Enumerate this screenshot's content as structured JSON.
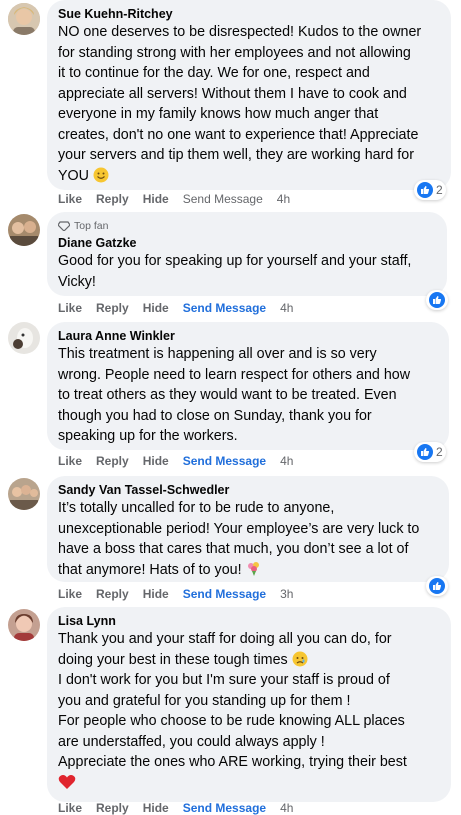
{
  "comments": [
    {
      "author": "Sue Kuehn-Ritchey",
      "lines": [
        "NO one deserves to be disrespected! Kudos to the owner",
        "for standing strong with her employees and not allowing",
        "it to continue for the day. We for one, respect and",
        "appreciate all servers! Without them I have to cook and",
        "everyone in my family knows how much anger that",
        "creates, don't no one want to experience that! Appreciate",
        "your servers and tip them well, they are working hard for",
        "YOU"
      ],
      "actions": {
        "like": "Like",
        "reply": "Reply",
        "hide": "Hide",
        "send": "Send Message",
        "time": "4h"
      },
      "reaction_count": "2"
    },
    {
      "badge": "Top fan",
      "author": "Diane Gatzke",
      "lines": [
        "Good for you for speaking up for yourself and your staff,",
        "Vicky!"
      ],
      "actions": {
        "like": "Like",
        "reply": "Reply",
        "hide": "Hide",
        "send": "Send Message",
        "time": "4h"
      }
    },
    {
      "author": "Laura Anne Winkler",
      "lines": [
        "This treatment is happening all over and is so very",
        "wrong. People need to learn respect for others and how",
        "to treat others as they would want to be treated. Even",
        "though you had to close on Sunday, thank you for",
        "speaking up for the workers."
      ],
      "actions": {
        "like": "Like",
        "reply": "Reply",
        "hide": "Hide",
        "send": "Send Message",
        "time": "4h"
      },
      "reaction_count": "2"
    },
    {
      "author": "Sandy Van Tassel-Schwedler",
      "lines": [
        "It’s totally uncalled for to be rude to anyone,",
        "unexceptionable period! Your employee’s are very luck to",
        "have a boss that cares that much, you don’t see a lot of",
        "that anymore! Hats of to you!"
      ],
      "actions": {
        "like": "Like",
        "reply": "Reply",
        "hide": "Hide",
        "send": "Send Message",
        "time": "3h"
      }
    },
    {
      "author": "Lisa Lynn",
      "lines": [
        "Thank you and your staff for doing all you can do, for",
        "doing your best in these tough times",
        "I don't work for you but I'm sure your staff is proud of",
        "you and grateful for you standing up for them !",
        "For people who choose to be rude knowing ALL places",
        "are understaffed, you could always apply !",
        "Appreciate the ones who ARE working, trying their best"
      ],
      "actions": {
        "like": "Like",
        "reply": "Reply",
        "hide": "Hide",
        "send": "Send Message",
        "time": "4h"
      }
    }
  ]
}
